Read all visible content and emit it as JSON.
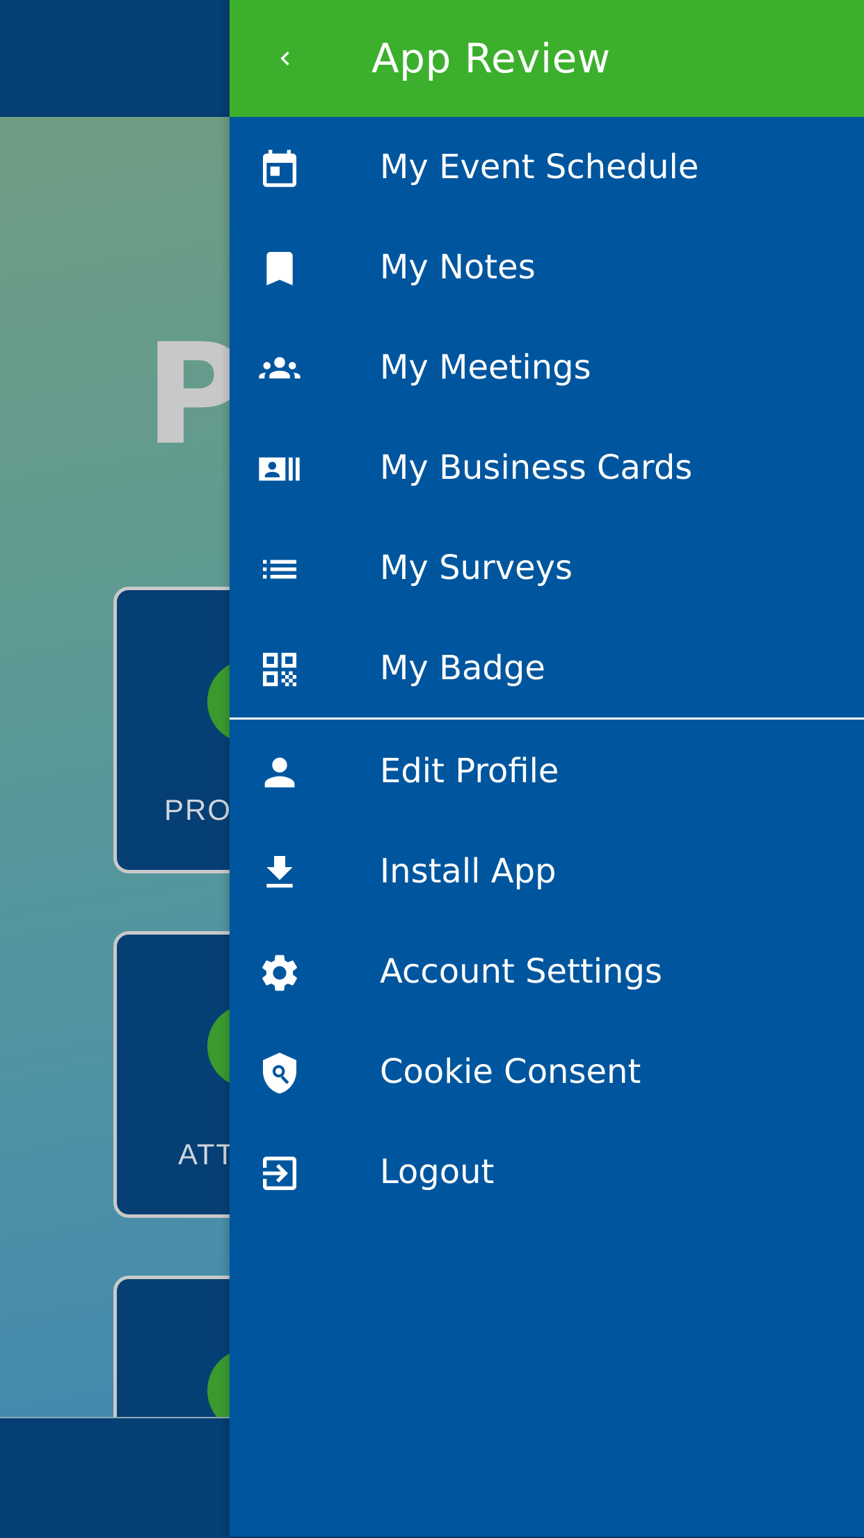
{
  "background": {
    "title_fragment": "P",
    "tiles": [
      {
        "label": "PROG"
      },
      {
        "label": "ATT"
      },
      {
        "label": ""
      }
    ]
  },
  "drawer": {
    "title": "App Review",
    "back_icon": "chevron-left-icon",
    "menu": [
      {
        "label": "My Event Schedule",
        "icon": "calendar-icon"
      },
      {
        "label": "My Notes",
        "icon": "bookmark-icon"
      },
      {
        "label": "My Meetings",
        "icon": "people-icon"
      },
      {
        "label": "My Business Cards",
        "icon": "business-card-icon"
      },
      {
        "label": "My Surveys",
        "icon": "list-icon"
      },
      {
        "label": "My Badge",
        "icon": "qr-code-icon"
      }
    ],
    "account_menu": [
      {
        "label": "Edit Profile",
        "icon": "person-icon"
      },
      {
        "label": "Install App",
        "icon": "download-icon"
      },
      {
        "label": "Account Settings",
        "icon": "gear-icon"
      },
      {
        "label": "Cookie Consent",
        "icon": "shield-search-icon"
      },
      {
        "label": "Logout",
        "icon": "logout-icon"
      }
    ]
  },
  "colors": {
    "drawer_bg": "#00569e",
    "header_green": "#3caf2d",
    "app_navy": "#053f73"
  }
}
